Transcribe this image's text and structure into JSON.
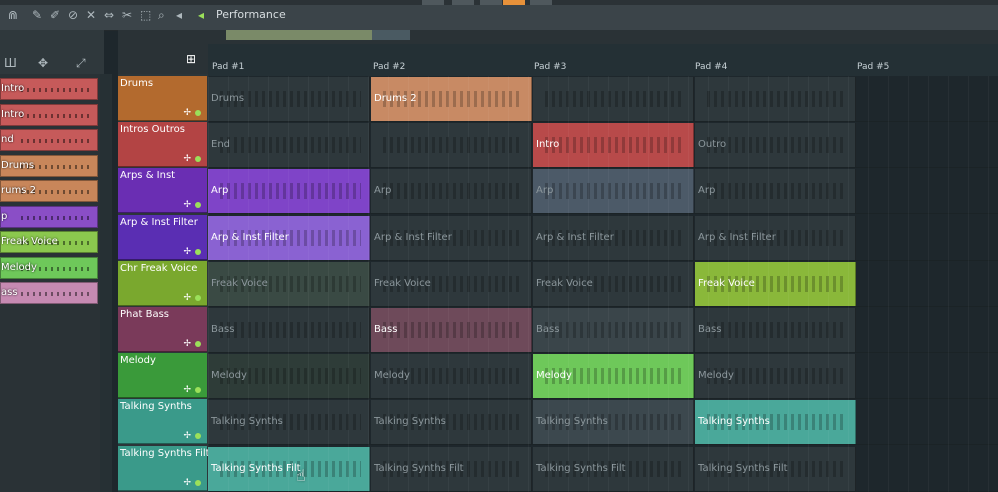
{
  "toolbar": {
    "title": "Performance"
  },
  "pads": [
    "Pad #1",
    "Pad #2",
    "Pad #3",
    "Pad #4",
    "Pad #5"
  ],
  "left_panel": {
    "items": [
      {
        "label": "Intro",
        "color": "#c65a5a"
      },
      {
        "label": "Intro",
        "color": "#c65a5a"
      },
      {
        "label": "nd",
        "color": "#c65a5a"
      },
      {
        "label": "Drums",
        "color": "#c8865a"
      },
      {
        "label": "rums 2",
        "color": "#c8865a"
      },
      {
        "label": "p",
        "color": "#8a4ec6"
      },
      {
        "label": "Freak Voice",
        "color": "#8bc84e"
      },
      {
        "label": "Melody",
        "color": "#6ec85a"
      },
      {
        "label": "ass",
        "color": "#c68ab2"
      }
    ]
  },
  "tracks": [
    {
      "name": "Drums",
      "color": "#b36a2e",
      "clips": [
        {
          "label": "Drums",
          "state": "dim",
          "color": "#2e383c"
        },
        {
          "label": "Drums 2",
          "state": "on",
          "color": "#c88a64"
        },
        {
          "label": "",
          "state": "dim",
          "color": "#2e383c"
        },
        {
          "label": "",
          "state": "dim",
          "color": "#2e383c"
        }
      ]
    },
    {
      "name": "Intros Outros",
      "color": "#b34444",
      "clips": [
        {
          "label": "End",
          "state": "dim",
          "color": "#2e383c"
        },
        {
          "label": "",
          "state": "dim",
          "color": "#2e383c"
        },
        {
          "label": "Intro",
          "state": "on",
          "color": "#b84a4a"
        },
        {
          "label": "Outro",
          "state": "dim",
          "color": "#2e383c"
        }
      ]
    },
    {
      "name": "Arps & Inst",
      "color": "#6a2eb3",
      "clips": [
        {
          "label": "Arp",
          "state": "on",
          "color": "#7f44c8"
        },
        {
          "label": "Arp",
          "state": "dim",
          "color": "#2e383c"
        },
        {
          "label": "Arp",
          "state": "dim",
          "color": "#4c5a68"
        },
        {
          "label": "Arp",
          "state": "dim",
          "color": "#2e383c"
        }
      ]
    },
    {
      "name": "Arp & Inst Filter",
      "color": "#5a2eb3",
      "clips": [
        {
          "label": "Arp & Inst Filter",
          "state": "on",
          "color": "#8a62d2"
        },
        {
          "label": "Arp & Inst Filter",
          "state": "dim",
          "color": "#2e383c"
        },
        {
          "label": "Arp & Inst Filter",
          "state": "dim",
          "color": "#2e383c"
        },
        {
          "label": "Arp & Inst Filter",
          "state": "dim",
          "color": "#2e383c"
        }
      ]
    },
    {
      "name": "Chr Freak Voice",
      "color": "#7aa82e",
      "clips": [
        {
          "label": "Freak Voice",
          "state": "dim",
          "color": "#3a4a44"
        },
        {
          "label": "Freak Voice",
          "state": "dim",
          "color": "#2e383c"
        },
        {
          "label": "Freak Voice",
          "state": "dim",
          "color": "#2e383c"
        },
        {
          "label": "Freak Voice",
          "state": "on",
          "color": "#8ab83a"
        }
      ]
    },
    {
      "name": "Phat Bass",
      "color": "#7a3a5a",
      "clips": [
        {
          "label": "Bass",
          "state": "dim",
          "color": "#2e383c"
        },
        {
          "label": "Bass",
          "state": "on",
          "color": "#6e4a5a"
        },
        {
          "label": "Bass",
          "state": "dim",
          "color": "#3a454a"
        },
        {
          "label": "Bass",
          "state": "dim",
          "color": "#2e383c"
        }
      ]
    },
    {
      "name": "Melody",
      "color": "#3a9a3a",
      "clips": [
        {
          "label": "Melody",
          "state": "dim",
          "color": "#2e3c38"
        },
        {
          "label": "Melody",
          "state": "dim",
          "color": "#2e383c"
        },
        {
          "label": "Melody",
          "state": "on",
          "color": "#6ec85a"
        },
        {
          "label": "Melody",
          "state": "dim",
          "color": "#2e383c"
        }
      ]
    },
    {
      "name": "Talking Synths",
      "color": "#3a9a8a",
      "clips": [
        {
          "label": "Talking Synths",
          "state": "dim",
          "color": "#2e383c"
        },
        {
          "label": "Talking Synths",
          "state": "dim",
          "color": "#2e383c"
        },
        {
          "label": "Talking Synths",
          "state": "dim",
          "color": "#3c484e"
        },
        {
          "label": "Talking Synths",
          "state": "on",
          "color": "#4aa89a"
        }
      ]
    },
    {
      "name": "Talking Synths Filt",
      "color": "#3a9a8a",
      "clips": [
        {
          "label": "Talking Synths Filt",
          "state": "on",
          "color": "#4aa89a"
        },
        {
          "label": "Talking Synths Filt",
          "state": "dim",
          "color": "#2e383c"
        },
        {
          "label": "Talking Synths Filt",
          "state": "dim",
          "color": "#2e383c"
        },
        {
          "label": "Talking Synths Filt",
          "state": "dim",
          "color": "#2e383c"
        }
      ]
    }
  ]
}
